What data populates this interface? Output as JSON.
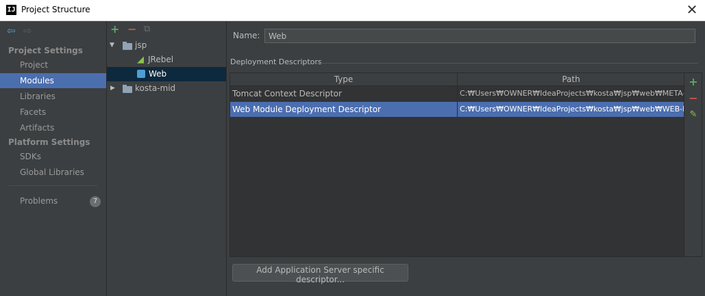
{
  "window": {
    "title": "Project Structure",
    "logo": "IJ"
  },
  "nav": {
    "sections": [
      {
        "title": "Project Settings",
        "items": [
          "Project",
          "Modules",
          "Libraries",
          "Facets",
          "Artifacts"
        ]
      },
      {
        "title": "Platform Settings",
        "items": [
          "SDKs",
          "Global Libraries"
        ]
      }
    ],
    "selected": "Modules",
    "problems": {
      "label": "Problems",
      "count": "7"
    }
  },
  "tree": {
    "nodes": [
      {
        "label": "jsp"
      },
      {
        "label": "JRebel"
      },
      {
        "label": "Web"
      },
      {
        "label": "kosta-mid"
      }
    ],
    "selected": "Web"
  },
  "form": {
    "name_label": "Name:",
    "name_value": "Web"
  },
  "descriptors": {
    "group_title": "Deployment Descriptors",
    "columns": [
      "Type",
      "Path"
    ],
    "rows": [
      {
        "type": "Tomcat Context Descriptor",
        "path": "C:₩Users₩OWNER₩IdeaProjects₩kosta₩jsp₩web₩META-INF"
      },
      {
        "type": "Web Module Deployment Descriptor",
        "path": "C:₩Users₩OWNER₩IdeaProjects₩kosta₩jsp₩web₩WEB-INF₩"
      }
    ],
    "selected_row": 1
  },
  "buttons": {
    "add_app_server": "Add Application Server specific descriptor..."
  },
  "colors": {
    "accent": "#4b6eaf",
    "add_green": "#59a869",
    "remove_red": "#c75450"
  }
}
